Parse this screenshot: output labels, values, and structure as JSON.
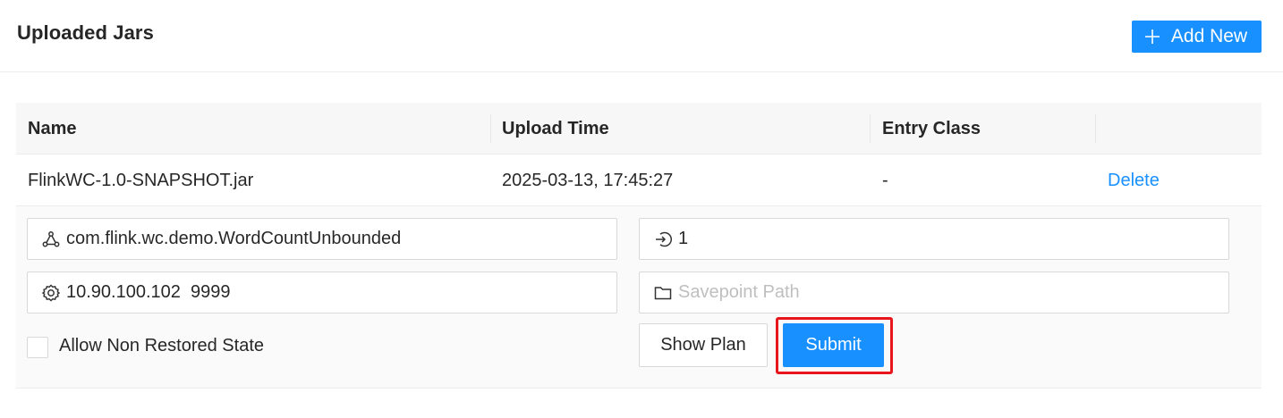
{
  "header": {
    "title": "Uploaded Jars",
    "add_button_label": "Add New"
  },
  "table": {
    "columns": [
      "Name",
      "Upload Time",
      "Entry Class",
      ""
    ],
    "rows": [
      {
        "name": "FlinkWC-1.0-SNAPSHOT.jar",
        "upload_time": "2025-03-13, 17:45:27",
        "entry_class": "-",
        "action_label": "Delete"
      }
    ]
  },
  "submit_form": {
    "entry_class_value": "com.flink.wc.demo.WordCountUnbounded",
    "parallelism_value": "1",
    "program_args_value": "10.90.100.102  9999",
    "savepoint_placeholder": "Savepoint Path",
    "allow_non_restored_label": "Allow Non Restored State",
    "allow_non_restored_checked": false,
    "show_plan_label": "Show Plan",
    "submit_label": "Submit"
  },
  "colors": {
    "primary": "#1890ff",
    "highlight": "#e8161c"
  },
  "icons": {
    "add": "plus-icon",
    "entry_class": "cluster-icon",
    "parallelism": "login-icon",
    "program_args": "setting-icon",
    "savepoint": "folder-icon"
  }
}
